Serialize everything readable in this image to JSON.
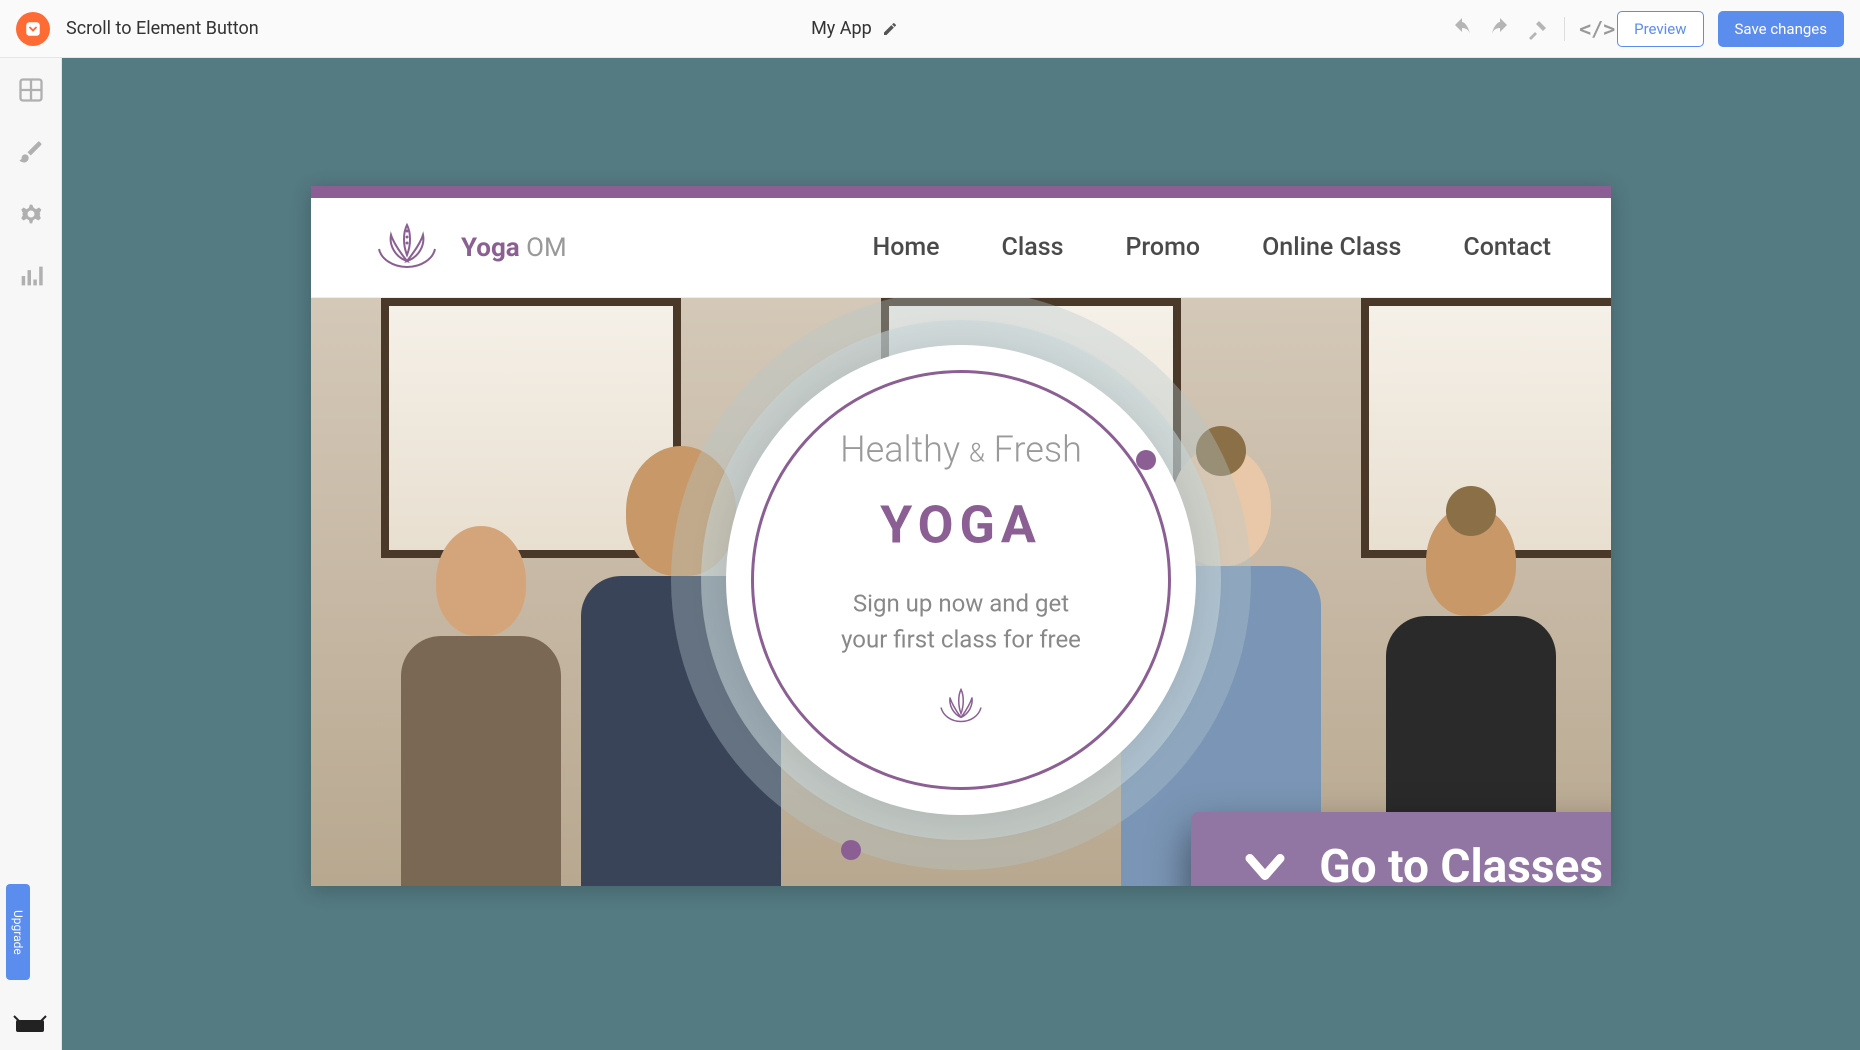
{
  "topbar": {
    "breadcrumb": "Scroll to Element Button",
    "app_name": "My App",
    "preview_label": "Preview",
    "save_label": "Save changes"
  },
  "sidebar": {
    "upgrade_label": "Upgrade"
  },
  "site": {
    "logo_bold": "Yoga",
    "logo_light": "OM",
    "nav": [
      "Home",
      "Class",
      "Promo",
      "Online Class",
      "Contact"
    ],
    "hero": {
      "tag_a": "Healthy",
      "tag_amp": "&",
      "tag_b": "Fresh",
      "title": "YOGA",
      "sub1": "Sign up now and get",
      "sub2": "your first class for free"
    },
    "cta_label": "Go to Classes"
  }
}
